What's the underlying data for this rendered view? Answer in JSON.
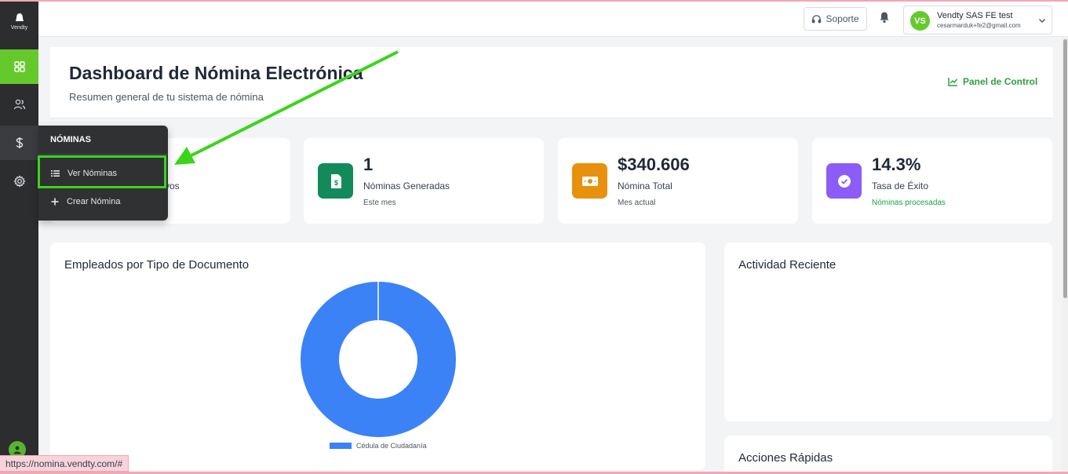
{
  "app": {
    "logo_text": "Vendty"
  },
  "header": {
    "support_label": "Soporte",
    "user": {
      "initials": "VS",
      "name": "Vendty SAS FE test",
      "email": "cesarmarduk+fe2@gmail.com"
    }
  },
  "page": {
    "title": "Dashboard de Nómina Electrónica",
    "subtitle": "Resumen general de tu sistema de nómina",
    "panel_link": "Panel de Control"
  },
  "stats": [
    {
      "value": "",
      "label": "tivos",
      "sub": ""
    },
    {
      "value": "1",
      "label": "Nóminas Generadas",
      "sub": "Este mes",
      "color": "#138a5b"
    },
    {
      "value": "$340.606",
      "label": "Nómina Total",
      "sub": "Mes actual",
      "color": "#e8910c"
    },
    {
      "value": "14.3%",
      "label": "Tasa de Éxito",
      "sub": "Nóminas procesadas",
      "color": "#8b5cf6"
    }
  ],
  "dropdown": {
    "header": "NÓMINAS",
    "items": [
      {
        "label": "Ver Nóminas",
        "icon": "list-icon"
      },
      {
        "label": "Crear Nómina",
        "icon": "plus-icon"
      }
    ]
  },
  "chart_card": {
    "title": "Empleados por Tipo de Documento"
  },
  "chart_data": {
    "type": "pie",
    "donut": true,
    "categories": [
      "Cédula de Ciudadanía"
    ],
    "values": [
      1
    ],
    "colors": [
      "#3b82f6"
    ],
    "legend": "bottom"
  },
  "activity": {
    "title": "Actividad Reciente"
  },
  "quick_actions": {
    "title": "Acciones Rápidas"
  },
  "status_url": "https://nomina.vendty.com/#",
  "colors": {
    "brand_green": "#65c92c",
    "sidebar": "#2b2d2f",
    "annotation": "#3bd41c"
  }
}
